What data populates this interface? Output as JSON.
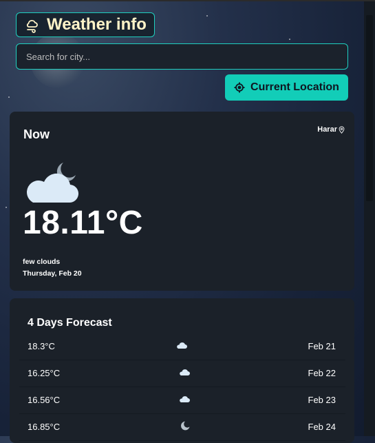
{
  "header": {
    "brand_icon": "cloud-wind-icon",
    "title": "Weather info"
  },
  "search": {
    "placeholder": "Search for city..."
  },
  "location_button": {
    "icon": "crosshair-icon",
    "label": "Current Location"
  },
  "now": {
    "heading": "Now",
    "city": "Harar",
    "city_icon": "map-pin-icon",
    "weather_icon": "cloud-moon-icon",
    "temperature": "18.11°C",
    "condition": "few clouds",
    "date": "Thursday, Feb 20"
  },
  "forecast": {
    "heading": "4 Days Forecast",
    "days": [
      {
        "temp": "18.3°C",
        "icon": "cloud-icon",
        "date": "Feb 21"
      },
      {
        "temp": "16.25°C",
        "icon": "cloud-icon",
        "date": "Feb 22"
      },
      {
        "temp": "16.56°C",
        "icon": "cloud-icon",
        "date": "Feb 23"
      },
      {
        "temp": "16.85°C",
        "icon": "moon-icon",
        "date": "Feb 24"
      }
    ]
  },
  "colors": {
    "accent": "#12cdb8",
    "card_bg": "#1b2129",
    "title_text": "#fff3c8"
  }
}
